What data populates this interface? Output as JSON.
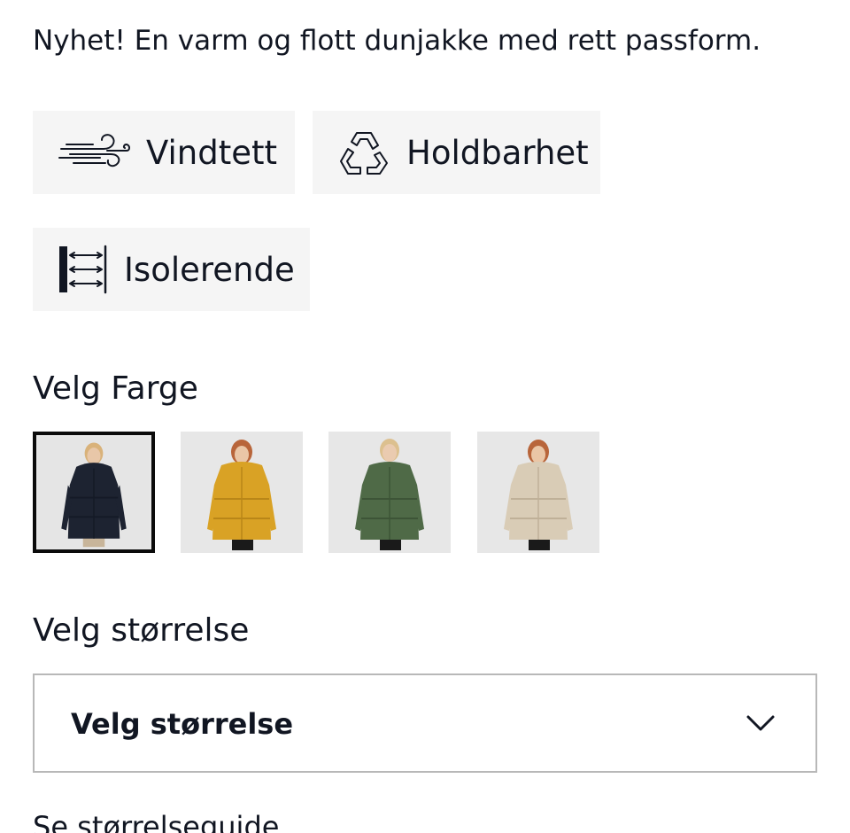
{
  "product": {
    "intro": "Nyhet! En varm og flott dunjakke med rett passform."
  },
  "features": [
    {
      "label": "Vindtett",
      "icon": "wind-icon"
    },
    {
      "label": "Holdbarhet",
      "icon": "recycle-icon"
    },
    {
      "label": "Isolerende",
      "icon": "insulation-icon"
    }
  ],
  "color_picker": {
    "label": "Velg Farge",
    "options": [
      {
        "color": "#1d2331",
        "icon": "navy-jacket-thumbnail",
        "selected": true
      },
      {
        "color": "#d9a225",
        "icon": "mustard-jacket-thumbnail",
        "selected": false
      },
      {
        "color": "#4f6a47",
        "icon": "green-jacket-thumbnail",
        "selected": false
      },
      {
        "color": "#d9ccb6",
        "icon": "beige-jacket-thumbnail",
        "selected": false
      }
    ]
  },
  "size_picker": {
    "label": "Velg størrelse",
    "selected_value": "Velg størrelse",
    "icon": "chevron-down-icon"
  },
  "size_guide": {
    "link_text": "Se størrelseguide"
  },
  "colors": {
    "text": "#111622",
    "feature_bg": "#f5f5f5",
    "select_border": "#b8b8b8",
    "selected_border": "#0b0b0b"
  }
}
